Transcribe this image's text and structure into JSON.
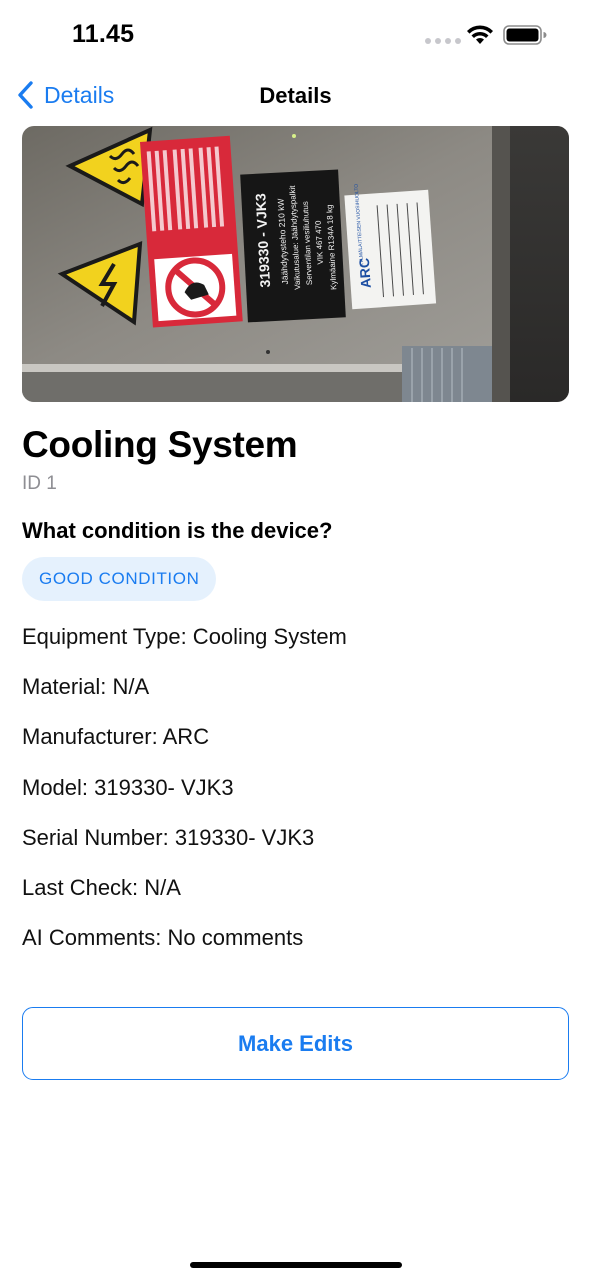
{
  "status_bar": {
    "time": "11.45"
  },
  "nav": {
    "back_label": "Details",
    "title": "Details"
  },
  "photo": {
    "sign_code": "319330 - VJK3",
    "sign_line1": "Jäähdytysteho   210 kW",
    "sign_line2": "Vaikutusalue: Jäähdytyspalkit",
    "sign_line3": "Serventilan vesiliuhutus",
    "sign_line4": "VIK 467 470",
    "sign_line5": "Kylmäaine R134A 18 kg",
    "label_brand": "ARC",
    "label_heading": "KYLMÄLAITTEISEN VUOSIHUOLTO"
  },
  "device": {
    "title": "Cooling System",
    "id": "ID 1",
    "question": "What condition is the device?",
    "condition": "GOOD CONDITION"
  },
  "details": [
    "Equipment Type: Cooling System",
    "Material: N/A",
    "Manufacturer: ARC",
    "Model: 319330- VJK3",
    "Serial Number: 319330- VJK3",
    "Last Check: N/A",
    "AI Comments: No comments"
  ],
  "actions": {
    "edit_label": "Make Edits"
  },
  "colors": {
    "accent": "#1a7cf0",
    "badge_bg": "#e5f1fd",
    "secondary_text": "#8e8e93"
  }
}
